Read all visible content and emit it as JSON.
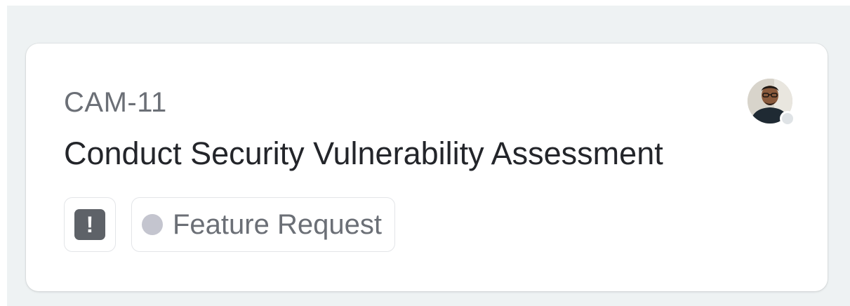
{
  "issue": {
    "id": "CAM-11",
    "title": "Conduct Security Vulnerability Assessment",
    "priority": {
      "icon": "urgent-priority-icon",
      "glyph": "!",
      "color": "#5e6268"
    },
    "label": {
      "text": "Feature Request",
      "color": "#c4c5cf"
    },
    "assignee": {
      "status_color": "#dfe3e6"
    }
  }
}
